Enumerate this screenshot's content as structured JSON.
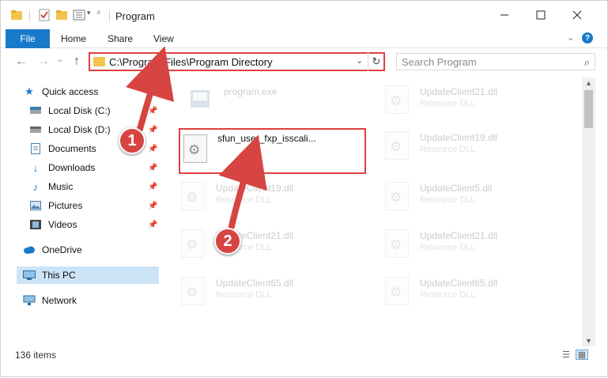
{
  "window": {
    "title": "Program"
  },
  "ribbon": {
    "file": "File",
    "home": "Home",
    "share": "Share",
    "view": "View"
  },
  "address": {
    "path": "C:\\Program Files\\Program Directory"
  },
  "search": {
    "placeholder": "Search Program"
  },
  "sidebar": {
    "items": [
      {
        "label": "Quick access",
        "icon": "star-icon"
      },
      {
        "label": "Local Disk (C:)",
        "icon": "drive-icon"
      },
      {
        "label": "Local Disk (D:)",
        "icon": "drive-icon"
      },
      {
        "label": "Documents",
        "icon": "documents-icon"
      },
      {
        "label": "Downloads",
        "icon": "download-icon"
      },
      {
        "label": "Music",
        "icon": "music-icon"
      },
      {
        "label": "Pictures",
        "icon": "pictures-icon"
      },
      {
        "label": "Videos",
        "icon": "videos-icon"
      },
      {
        "label": "OneDrive",
        "icon": "cloud-icon"
      },
      {
        "label": "This PC",
        "icon": "computer-icon"
      },
      {
        "label": "Network",
        "icon": "network-icon"
      }
    ]
  },
  "files": [
    {
      "name": "program.exe",
      "type": ""
    },
    {
      "name": "UpdateClient21.dll",
      "type": "Resource DLL"
    },
    {
      "name": "sfun_user_fxp_isscali...",
      "type": ""
    },
    {
      "name": "UpdateClient19.dll",
      "type": "Resource DLL"
    },
    {
      "name": "UpdateClient19.dll",
      "type": "Resource DLL"
    },
    {
      "name": "UpdateClient5.dll",
      "type": "Resource DLL"
    },
    {
      "name": "UpdateClient21.dll",
      "type": "Resource DLL"
    },
    {
      "name": "UpdateClient21.dll",
      "type": "Resource DLL"
    },
    {
      "name": "UpdateClient65.dll",
      "type": "Resource DLL"
    },
    {
      "name": "UpdateClient65.dll",
      "type": "Resource DLL"
    }
  ],
  "status": {
    "count": "136 items"
  },
  "annotations": {
    "step1": "1",
    "step2": "2",
    "highlight_color": "#e04040",
    "badge_color": "#d64541"
  },
  "colors": {
    "accent": "#1979ca",
    "selected": "#cce4f7"
  }
}
